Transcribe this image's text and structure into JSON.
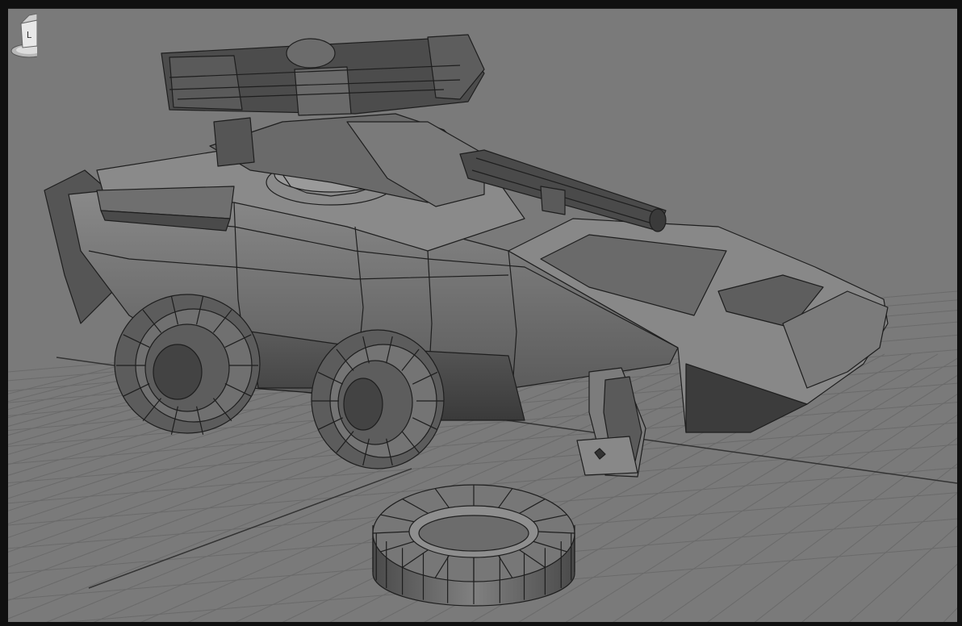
{
  "app": {
    "panel": "viewport-perspective",
    "background_color": "#7a7a7a",
    "frame_color": "#101010"
  },
  "scene": {
    "grid": true,
    "objects": [
      "armored-vehicle",
      "loose-tire"
    ],
    "shading": "smooth-shade-wireframe-on-shaded",
    "wire_color": "#1e1e1e"
  },
  "viewcube": {
    "label": "L"
  }
}
